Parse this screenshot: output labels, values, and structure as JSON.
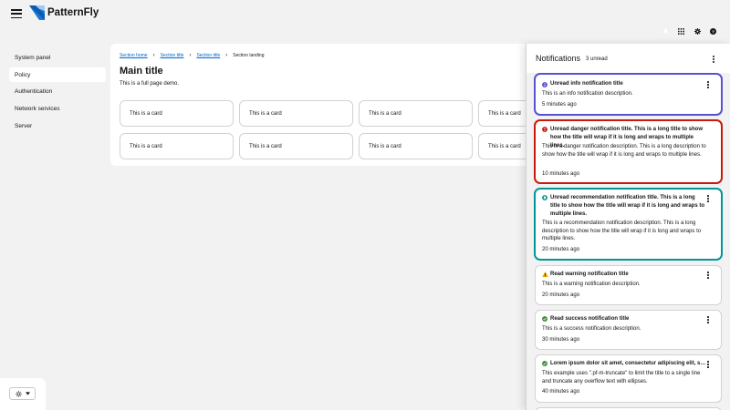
{
  "header": {
    "brand": "PatternFly",
    "brand_colors": {
      "logo_blue": "#1a78d6",
      "logo_light": "#a4c9f0"
    },
    "tools": [
      {
        "icon": "bell-icon"
      },
      {
        "icon": "grid-icon"
      },
      {
        "icon": "gear-icon"
      },
      {
        "icon": "help-icon"
      }
    ]
  },
  "sidebar": {
    "items": [
      {
        "label": "System panel",
        "current": false
      },
      {
        "label": "Policy",
        "current": true
      },
      {
        "label": "Authentication",
        "current": false
      },
      {
        "label": "Network services",
        "current": false
      },
      {
        "label": "Server",
        "current": false
      }
    ],
    "theme_icon": "sun-icon"
  },
  "main": {
    "breadcrumb": [
      {
        "label": "Section home",
        "link": true
      },
      {
        "label": "Section title",
        "link": true
      },
      {
        "label": "Section title",
        "link": true
      },
      {
        "label": "Section landing",
        "link": false
      }
    ],
    "title": "Main title",
    "description": "This is a full page demo.",
    "cards": [
      "This is a card",
      "This is a card",
      "This is a card",
      "This is a card",
      "This is a card",
      "This is a card",
      "This is a card",
      "This is a card"
    ]
  },
  "drawer": {
    "title": "Notifications",
    "count": "3 unread",
    "colors": {
      "info": "#5752d1",
      "danger": "#c9190b",
      "recommend": "#009596",
      "warning": "#f0ab00",
      "success": "#3e8635"
    },
    "notifications": [
      {
        "variant": "info",
        "unread": true,
        "title": "Unread info notification title",
        "description": "This is an info notification description.",
        "time": "5 minutes ago"
      },
      {
        "variant": "danger",
        "unread": true,
        "title": "Unread danger notification title. This is a long title to show how the title will wrap if it is long and wraps to multiple lines.",
        "description": "This is a danger notification description. This is a long description to show how the title will wrap if it is long and wraps to multiple lines.",
        "time": "10 minutes ago"
      },
      {
        "variant": "recommend",
        "unread": true,
        "title": "Unread recommendation notification title. This is a long title to show how the title will wrap if it is long and wraps to multiple lines.",
        "description": "This is a recommendation notification description. This is a long description to show how the title will wrap if it is long and wraps to multiple lines.",
        "time": "20 minutes ago"
      },
      {
        "variant": "warning",
        "unread": false,
        "title": "Read warning notification title",
        "description": "This is a warning notification description.",
        "time": "20 minutes ago"
      },
      {
        "variant": "success",
        "unread": false,
        "title": "Read success notification title",
        "description": "This is a success notification description.",
        "time": "30 minutes ago"
      },
      {
        "variant": "success",
        "unread": false,
        "title": "Lorem ipsum dolor sit amet, consectetur adipiscing elit, sed do eiusmod tempor incididunt ut labore et dolore magna aliqua.",
        "description": "This example uses \".pf-m-truncate\" to limit the title to a single line and truncate any overflow text with ellipses.",
        "time": "40 minutes ago"
      }
    ]
  }
}
